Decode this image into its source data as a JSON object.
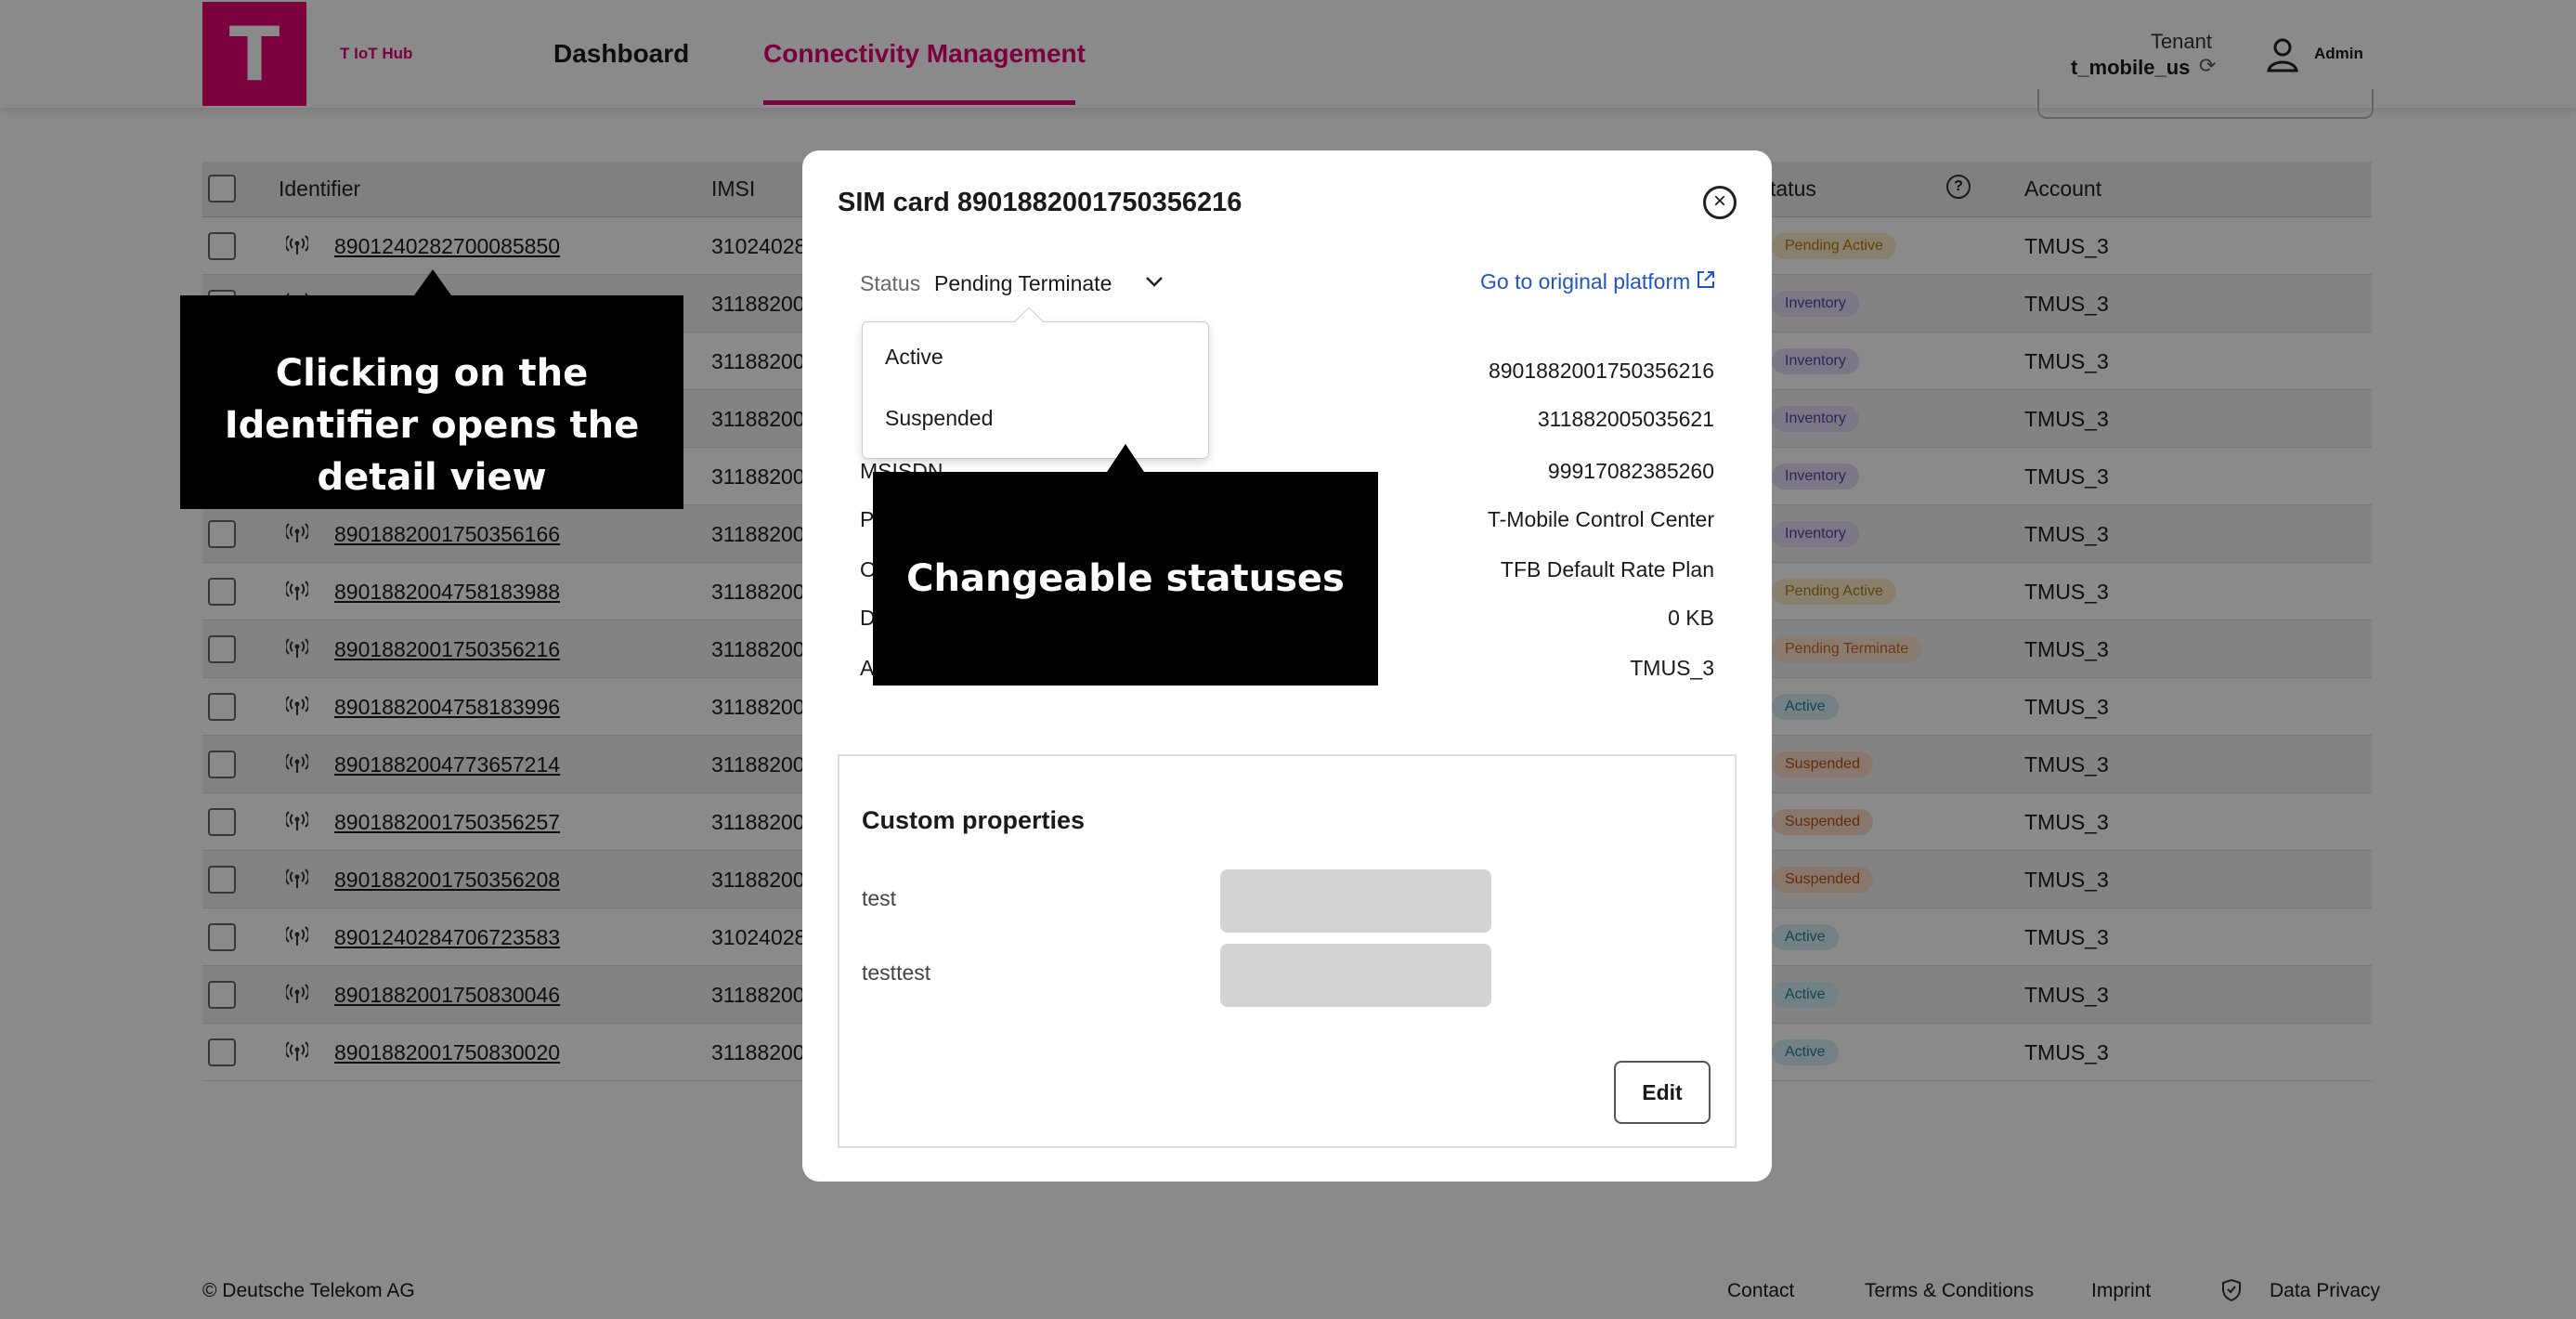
{
  "header": {
    "brand": "T IoT Hub",
    "logo_letter": "T",
    "nav": {
      "dashboard": "Dashboard",
      "connectivity": "Connectivity Management"
    },
    "tenant_label": "Tenant",
    "tenant_value": "t_mobile_us",
    "user_label": "Admin"
  },
  "table": {
    "columns": {
      "identifier": "Identifier",
      "imsi": "IMSI",
      "status": "tatus",
      "help": "?",
      "account": "Account"
    },
    "rows": [
      {
        "identifier": "8901240282700085850",
        "imsi": "31024028",
        "status": "Pending Active",
        "account": "TMUS_3"
      },
      {
        "identifier": "",
        "imsi": "31188200",
        "status": "Inventory",
        "account": "TMUS_3"
      },
      {
        "identifier": "",
        "imsi": "31188200",
        "status": "Inventory",
        "account": "TMUS_3"
      },
      {
        "identifier": "",
        "imsi": "31188200",
        "status": "Inventory",
        "account": "TMUS_3"
      },
      {
        "identifier": "",
        "imsi": "31188200",
        "status": "Inventory",
        "account": "TMUS_3"
      },
      {
        "identifier": "8901882001750356166",
        "imsi": "31188200",
        "status": "Inventory",
        "account": "TMUS_3"
      },
      {
        "identifier": "8901882004758183988",
        "imsi": "31188200",
        "status": "Pending Active",
        "account": "TMUS_3"
      },
      {
        "identifier": "8901882001750356216",
        "imsi": "31188200",
        "status": "Pending Terminate",
        "account": "TMUS_3"
      },
      {
        "identifier": "8901882004758183996",
        "imsi": "31188200",
        "status": "Active",
        "account": "TMUS_3"
      },
      {
        "identifier": "8901882004773657214",
        "imsi": "31188200",
        "status": "Suspended",
        "account": "TMUS_3"
      },
      {
        "identifier": "8901882001750356257",
        "imsi": "31188200",
        "status": "Suspended",
        "account": "TMUS_3"
      },
      {
        "identifier": "8901882001750356208",
        "imsi": "31188200",
        "status": "Suspended",
        "account": "TMUS_3"
      },
      {
        "identifier": "8901240284706723583",
        "imsi": "31024028",
        "status": "Active",
        "account": "TMUS_3"
      },
      {
        "identifier": "8901882001750830046",
        "imsi": "31188200",
        "status": "Active",
        "account": "TMUS_3"
      },
      {
        "identifier": "8901882001750830020",
        "imsi": "31188200",
        "status": "Active",
        "account": "TMUS_3"
      }
    ]
  },
  "status_colors": {
    "Pending Active": {
      "bg": "#fbecc8",
      "fg": "#b07a10"
    },
    "Inventory": {
      "bg": "#e3dcf6",
      "fg": "#5a3ea8"
    },
    "Pending Terminate": {
      "bg": "#fde3cf",
      "fg": "#c8641c"
    },
    "Active": {
      "bg": "#d6eef4",
      "fg": "#1e7f99"
    },
    "Suspended": {
      "bg": "#fbdcc8",
      "fg": "#b84e14"
    }
  },
  "modal": {
    "title": "SIM card 8901882001750356216",
    "close_icon": "×",
    "status_label": "Status",
    "status_value": "Pending Terminate",
    "original_link": "Go to original platform",
    "dropdown_options": [
      "Active",
      "Suspended"
    ],
    "details": [
      {
        "label": "",
        "value": "8901882001750356216"
      },
      {
        "label": "",
        "value": "311882005035621"
      },
      {
        "label": "MSISDN",
        "value": "99917082385260"
      },
      {
        "label": "P",
        "value": "T-Mobile Control Center"
      },
      {
        "label": "O",
        "value": "TFB Default Rate Plan"
      },
      {
        "label": "D",
        "value": "0 KB"
      },
      {
        "label": "A",
        "value": "TMUS_3"
      }
    ],
    "custom_properties": {
      "title": "Custom properties",
      "items": [
        {
          "label": "test"
        },
        {
          "label": "testtest"
        }
      ],
      "edit_label": "Edit"
    }
  },
  "annotations": {
    "identifier_hint": "Clicking on the Identifier opens the detail view",
    "status_hint": "Changeable statuses"
  },
  "footer": {
    "copyright": "© Deutsche Telekom AG",
    "links": {
      "contact": "Contact",
      "terms": "Terms & Conditions",
      "imprint": "Imprint",
      "privacy": "Data Privacy"
    }
  },
  "colors": {
    "brand": "#e20074",
    "link": "#2255c4"
  }
}
